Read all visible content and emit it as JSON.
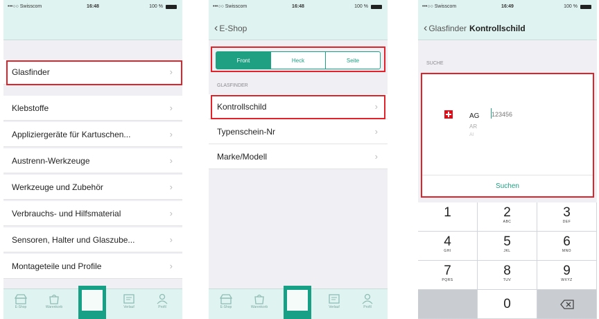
{
  "status": {
    "carrier": "•••○○ Swisscom",
    "battery": "100 %"
  },
  "screen1": {
    "time": "16:48",
    "top_item": "Glasfinder",
    "items": [
      "Klebstoffe",
      "Appliziergeräte für Kartuschen...",
      "Austrenn-Werkzeuge",
      "Werkzeuge und Zubehör",
      "Verbrauchs- und Hilfsmaterial",
      "Sensoren, Halter und Glaszube...",
      "Montageteile und Profile"
    ]
  },
  "screen2": {
    "time": "16:48",
    "back_label": "E-Shop",
    "segments": [
      "Front",
      "Heck",
      "Seite"
    ],
    "section": "GLASFINDER",
    "items": [
      "Kontrollschild",
      "Typenschein-Nr",
      "Marke/Modell"
    ]
  },
  "screen3": {
    "time": "16:49",
    "back_label": "Glasfinder",
    "title": "Kontrollschild",
    "section": "SUCHE",
    "cantons": [
      "AG",
      "AR",
      "AI"
    ],
    "plate_placeholder": "123456",
    "search_button": "Suchen",
    "keys": [
      {
        "num": "1",
        "letters": ""
      },
      {
        "num": "2",
        "letters": "ABC"
      },
      {
        "num": "3",
        "letters": "DEF"
      },
      {
        "num": "4",
        "letters": "GHI"
      },
      {
        "num": "5",
        "letters": "JKL"
      },
      {
        "num": "6",
        "letters": "MNO"
      },
      {
        "num": "7",
        "letters": "PQRS"
      },
      {
        "num": "8",
        "letters": "TUV"
      },
      {
        "num": "9",
        "letters": "WXYZ"
      },
      {
        "num": "0",
        "letters": ""
      }
    ]
  },
  "tabbar": {
    "labels": [
      "E-Shop",
      "Warenkorb",
      "",
      "Verlauf",
      "Profil"
    ]
  },
  "colors": {
    "accent": "#1fa083",
    "navbar": "#dff3f0",
    "highlight": "#e0232b"
  }
}
